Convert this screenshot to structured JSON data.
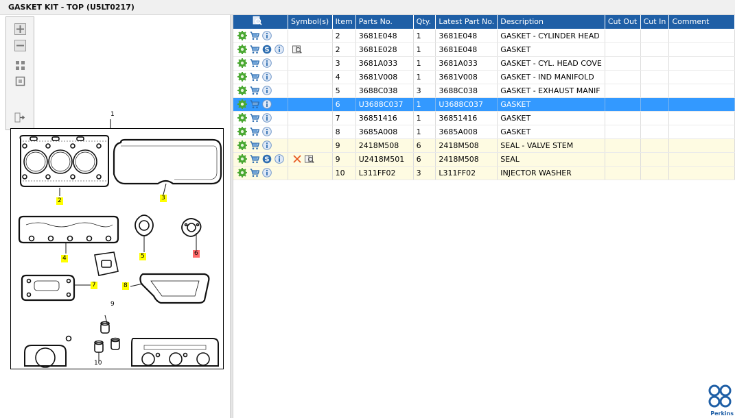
{
  "window": {
    "title": "GASKET KIT - TOP (U5LT0217)"
  },
  "viewer": {
    "assembly_label": "1",
    "callouts": [
      "2",
      "3",
      "4",
      "5",
      "6",
      "7",
      "8",
      "9",
      "10"
    ]
  },
  "table": {
    "headers": [
      "",
      "Symbol(s)",
      "Item",
      "Parts No.",
      "Qty.",
      "Latest Part No.",
      "Description",
      "Cut Out",
      "Cut In",
      "Comment"
    ],
    "rows": [
      {
        "item": "2",
        "part_no": "3681E048",
        "qty": "1",
        "latest": "3681E048",
        "desc": "GASKET - CYLINDER HEAD",
        "has_s": false,
        "symbols": []
      },
      {
        "item": "2",
        "part_no": "3681E028",
        "qty": "1",
        "latest": "3681E048",
        "desc": "GASKET",
        "has_s": true,
        "symbols": [
          "book"
        ]
      },
      {
        "item": "3",
        "part_no": "3681A033",
        "qty": "1",
        "latest": "3681A033",
        "desc": "GASKET - CYL. HEAD COVE",
        "has_s": false,
        "symbols": []
      },
      {
        "item": "4",
        "part_no": "3681V008",
        "qty": "1",
        "latest": "3681V008",
        "desc": "GASKET - IND MANIFOLD",
        "has_s": false,
        "symbols": []
      },
      {
        "item": "5",
        "part_no": "3688C038",
        "qty": "3",
        "latest": "3688C038",
        "desc": "GASKET - EXHAUST MANIF",
        "has_s": false,
        "symbols": []
      },
      {
        "item": "6",
        "part_no": "U3688C037",
        "qty": "1",
        "latest": "U3688C037",
        "desc": "GASKET",
        "has_s": false,
        "symbols": []
      },
      {
        "item": "7",
        "part_no": "36851416",
        "qty": "1",
        "latest": "36851416",
        "desc": "GASKET",
        "has_s": false,
        "symbols": []
      },
      {
        "item": "8",
        "part_no": "3685A008",
        "qty": "1",
        "latest": "3685A008",
        "desc": "GASKET",
        "has_s": false,
        "symbols": []
      },
      {
        "item": "9",
        "part_no": "2418M508",
        "qty": "6",
        "latest": "2418M508",
        "desc": "SEAL - VALVE STEM",
        "has_s": false,
        "symbols": []
      },
      {
        "item": "9",
        "part_no": "U2418M501",
        "qty": "6",
        "latest": "2418M508",
        "desc": "SEAL",
        "has_s": true,
        "symbols": [
          "cross",
          "book"
        ]
      },
      {
        "item": "10",
        "part_no": "L311FF02",
        "qty": "3",
        "latest": "L311FF02",
        "desc": "INJECTOR WASHER",
        "has_s": false,
        "symbols": []
      }
    ]
  },
  "brand": {
    "name": "Perkins"
  }
}
